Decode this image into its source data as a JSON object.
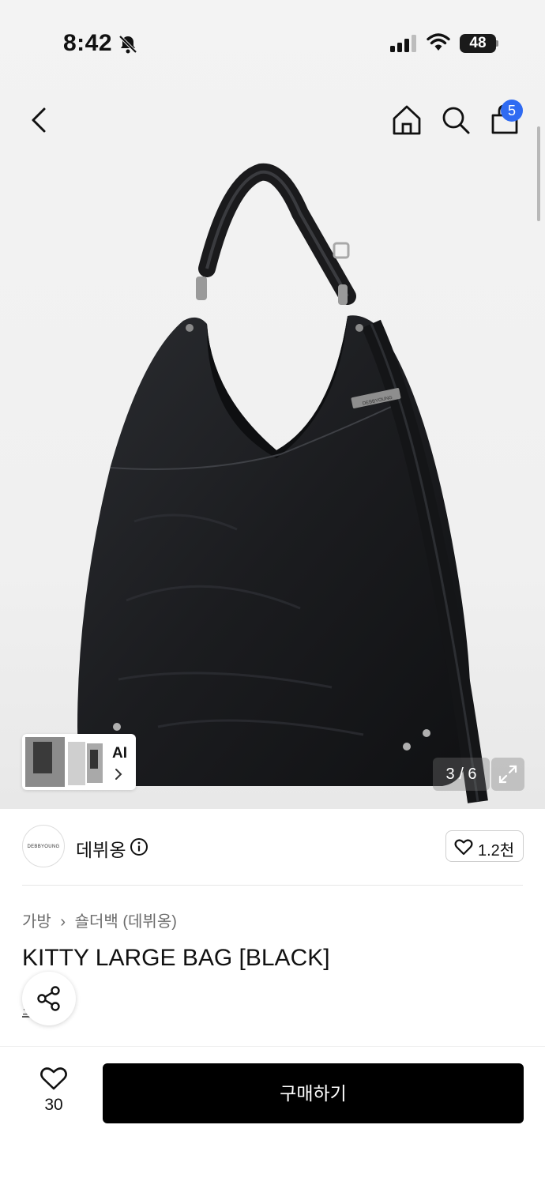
{
  "status_bar": {
    "time": "8:42",
    "battery": "48"
  },
  "nav": {
    "cart_count": "5"
  },
  "gallery": {
    "ai_label": "AI",
    "counter": "3 / 6",
    "brand_stamp": "DEBBYOUNG"
  },
  "brand": {
    "logo_text": "DEBBYOUNG",
    "name": "데뷔옹",
    "likes": "1.2천"
  },
  "breadcrumb": {
    "category": "가방",
    "subcategory": "숄더백 (데뷔옹)"
  },
  "product": {
    "title": "KITTY LARGE BAG [BLACK]",
    "link_text": "소개"
  },
  "bottom": {
    "wish_count": "30",
    "buy_label": "구매하기"
  },
  "colors": {
    "accent": "#2f6bf2",
    "button_bg": "#000000"
  }
}
